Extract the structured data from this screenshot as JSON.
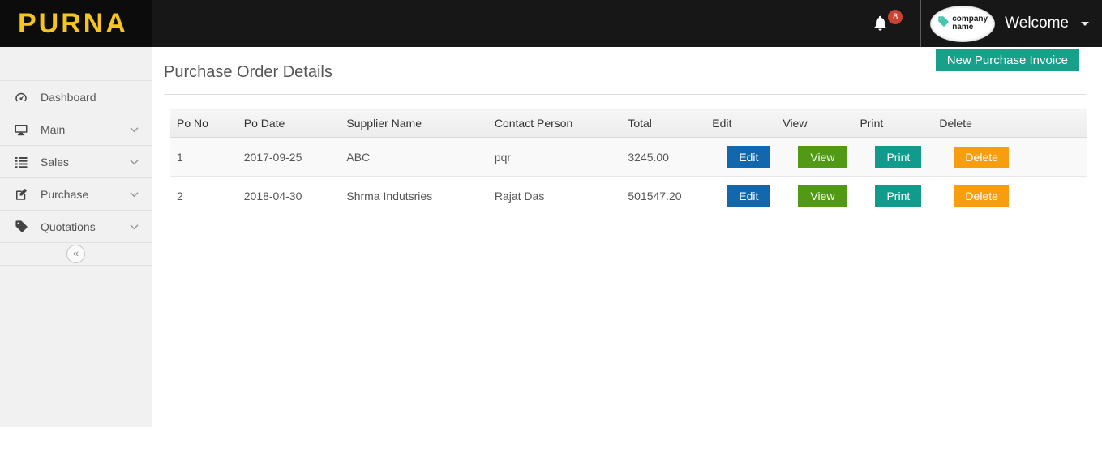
{
  "header": {
    "logo_text": "PURNA",
    "notification_count": "8",
    "company_name_line1": "company",
    "company_name_line2": "name",
    "welcome_label": "Welcome"
  },
  "sidebar": {
    "items": [
      {
        "label": "Dashboard",
        "icon": "dashboard-icon",
        "expandable": false
      },
      {
        "label": "Main",
        "icon": "desktop-icon",
        "expandable": true
      },
      {
        "label": "Sales",
        "icon": "list-icon",
        "expandable": true
      },
      {
        "label": "Purchase",
        "icon": "edit-square-icon",
        "expandable": true
      },
      {
        "label": "Quotations",
        "icon": "tag-icon",
        "expandable": true
      }
    ],
    "collapse_glyph": "«"
  },
  "main": {
    "page_title": "Purchase Order Details",
    "new_invoice_button_label": "New Purchase Invoice",
    "table": {
      "headers": [
        "Po No",
        "Po Date",
        "Supplier Name",
        "Contact Person",
        "Total",
        "Edit",
        "View",
        "Print",
        "Delete"
      ],
      "action_labels": {
        "edit": "Edit",
        "view": "View",
        "print": "Print",
        "delete": "Delete"
      },
      "rows": [
        {
          "po_no": "1",
          "po_date": "2017-09-25",
          "supplier_name": "ABC",
          "contact_person": "pqr",
          "total": "3245.00"
        },
        {
          "po_no": "2",
          "po_date": "2018-04-30",
          "supplier_name": "Shrma Indutsries",
          "contact_person": "Rajat Das",
          "total": "501547.20"
        }
      ]
    }
  },
  "colors": {
    "header_bg": "#171717",
    "logo_area_bg": "#0c0c0c",
    "logo_yellow": "#f6c51d",
    "badge_red": "#c74334",
    "accent_teal": "#17a189",
    "edit_blue": "#1368ad",
    "view_green": "#529a16",
    "print_teal": "#109b8d",
    "delete_orange": "#f89d0e"
  }
}
